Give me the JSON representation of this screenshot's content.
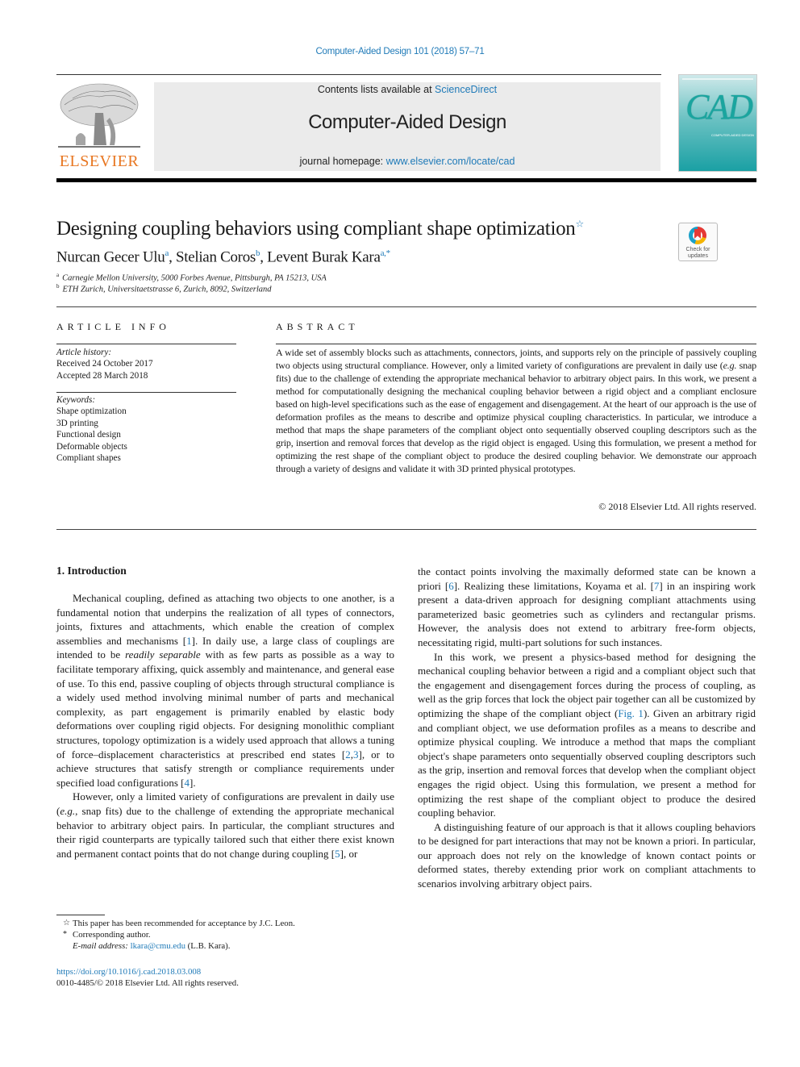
{
  "header": {
    "citation": "Computer-Aided Design 101 (2018) 57–71",
    "contents_prefix": "Contents lists available at ",
    "contents_link": "ScienceDirect",
    "journal_name": "Computer-Aided Design",
    "homepage_prefix": "journal homepage: ",
    "homepage_link": "www.elsevier.com/locate/cad",
    "publisher_logo_text": "ELSEVIER",
    "cover_title": "CAD",
    "cover_subtitle": "COMPUTER-AIDED DESIGN"
  },
  "crossmark": {
    "label_line1": "Check for",
    "label_line2": "updates"
  },
  "article": {
    "title": "Designing coupling behaviors using compliant shape optimization",
    "title_mark": "☆",
    "authors": [
      {
        "name": "Nurcan Gecer Ulu",
        "sup": "a"
      },
      {
        "name": "Stelian Coros",
        "sup": "b"
      },
      {
        "name": "Levent Burak Kara",
        "sup": "a,*"
      }
    ],
    "affiliations": [
      {
        "mark": "a",
        "text": "Carnegie Mellon University, 5000 Forbes Avenue, Pittsburgh, PA 15213, USA"
      },
      {
        "mark": "b",
        "text": "ETH Zurich, Universitaetstrasse 6, Zurich, 8092, Switzerland"
      }
    ]
  },
  "article_info": {
    "heading": "ARTICLE INFO",
    "history_label": "Article history:",
    "received": "Received 24 October 2017",
    "accepted": "Accepted 28 March 2018",
    "keywords_label": "Keywords:",
    "keywords": [
      "Shape optimization",
      "3D printing",
      "Functional design",
      "Deformable objects",
      "Compliant shapes"
    ]
  },
  "abstract": {
    "heading": "ABSTRACT",
    "text_1": "A wide set of assembly blocks such as attachments, connectors, joints, and supports rely on the principle of passively coupling two objects using structural compliance. However, only a limited variety of configurations are prevalent in daily use (",
    "text_eg": "e.g.",
    "text_2": " snap fits) due to the challenge of extending the appropriate mechanical behavior to arbitrary object pairs. In this work, we present a method for computationally designing the mechanical coupling behavior between a rigid object and a compliant enclosure based on high-level specifications such as the ease of engagement and disengagement. At the heart of our approach is the use of deformation profiles as the means to describe and optimize physical coupling characteristics. In particular, we introduce a method that maps the shape parameters of the compliant object onto sequentially observed coupling descriptors such as the grip, insertion and removal forces that develop as the rigid object is engaged. Using this formulation, we present a method for optimizing the rest shape of the compliant object to produce the desired coupling behavior. We demonstrate our approach through a variety of designs and validate it with 3D printed physical prototypes.",
    "copyright": "© 2018 Elsevier Ltd. All rights reserved."
  },
  "introduction": {
    "heading": "1.  Introduction",
    "p1_a": "Mechanical coupling, defined as attaching two objects to one another, is a fundamental notion that underpins the realization of all types of connectors, joints, fixtures and attachments, which enable the creation of complex assemblies and mechanisms [",
    "p1_ref1": "1",
    "p1_b": "]. In daily use, a large class of couplings are intended to be ",
    "p1_italic": "readily separable",
    "p1_c": " with as few parts as possible as a way to facilitate temporary affixing, quick assembly and maintenance, and general ease of use. To this end, passive coupling of objects through structural compliance is a widely used method involving minimal number of parts and mechanical complexity, as part engagement is primarily enabled by elastic body deformations over coupling rigid objects. For designing monolithic compliant structures, topology optimization is a widely used approach that allows a tuning of force–displacement characteristics at prescribed end states [",
    "p1_ref2": "2",
    "p1_ref3": "3",
    "p1_d": "], or to achieve structures that satisfy strength or compliance requirements under specified load configurations [",
    "p1_ref4": "4",
    "p1_e": "].",
    "p2_a": "However, only a limited variety of configurations are prevalent in daily use (",
    "p2_eg": "e.g.",
    "p2_b": ", snap fits) due to the challenge of extending the appropriate mechanical behavior to arbitrary object pairs. In particular, the compliant structures and their rigid counterparts are typically tailored such that either there exist known and permanent contact points that do not change during coupling [",
    "p2_ref5": "5",
    "p2_c": "], or",
    "r1_a": "the contact points involving the maximally deformed state can be known a priori [",
    "r1_ref6": "6",
    "r1_b": "]. Realizing these limitations, Koyama et al. [",
    "r1_ref7": "7",
    "r1_c": "] in an inspiring work present a data-driven approach for designing compliant attachments using parameterized basic geometries such as cylinders and rectangular prisms. However, the analysis does not extend to arbitrary free-form objects, necessitating rigid, multi-part solutions for such instances.",
    "r2_a": "In this work, we present a physics-based method for designing the mechanical coupling behavior between a rigid and a compliant object such that the engagement and disengagement forces during the process of coupling, as well as the grip forces that lock the object pair together can all be customized by optimizing the shape of the compliant object (",
    "r2_fig": "Fig. 1",
    "r2_b": "). Given an arbitrary rigid and compliant object, we use deformation profiles as a means to describe and optimize physical coupling. We introduce a method that maps the compliant object's shape parameters onto sequentially observed coupling descriptors such as the grip, insertion and removal forces that develop when the compliant object engages the rigid object. Using this formulation, we present a method for optimizing the rest shape of the compliant object to produce the desired coupling behavior.",
    "r3": "A distinguishing feature of our approach is that it allows coupling behaviors to be designed for part interactions that may not be known a priori. In particular, our approach does not rely on the knowledge of known contact points or deformed states, thereby extending prior work on compliant attachments to scenarios involving arbitrary object pairs."
  },
  "footnotes": {
    "star_mark": "☆",
    "star_text": "This paper has been recommended for acceptance by J.C. Leon.",
    "corr_mark": "*",
    "corr_text": "Corresponding author.",
    "email_label": "E-mail address:",
    "email": "lkara@cmu.edu",
    "email_suffix": " (L.B. Kara).",
    "doi": "https://doi.org/10.1016/j.cad.2018.03.008",
    "issn_line": "0010-4485/© 2018 Elsevier Ltd. All rights reserved."
  },
  "colors": {
    "link": "#1f7ab8",
    "elsevier_orange": "#e87722",
    "cover_teal": "#1aa0a4"
  }
}
